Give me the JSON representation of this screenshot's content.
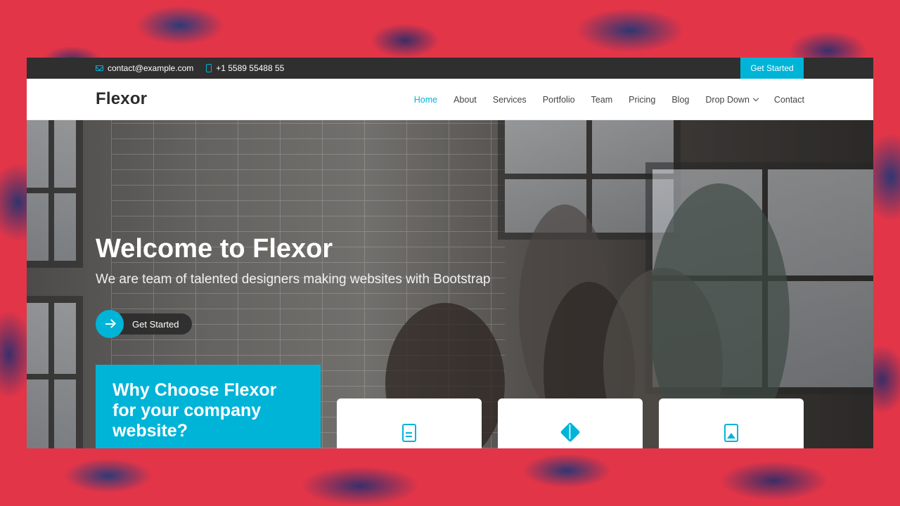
{
  "topbar": {
    "email": "contact@example.com",
    "phone": "+1 5589 55488 55",
    "cta_label": "Get Started"
  },
  "header": {
    "logo": "Flexor",
    "nav": [
      {
        "label": "Home",
        "active": true
      },
      {
        "label": "About"
      },
      {
        "label": "Services"
      },
      {
        "label": "Portfolio"
      },
      {
        "label": "Team"
      },
      {
        "label": "Pricing"
      },
      {
        "label": "Blog"
      },
      {
        "label": "Drop Down",
        "dropdown": true
      },
      {
        "label": "Contact"
      }
    ]
  },
  "hero": {
    "title": "Welcome to Flexor",
    "subtitle": "We are team of talented designers making websites with Bootstrap",
    "button_label": "Get Started"
  },
  "why": {
    "title": "Why Choose Flexor for your company website?"
  },
  "cards": [
    {
      "icon": "document-icon"
    },
    {
      "icon": "cube-icon"
    },
    {
      "icon": "image-file-icon"
    }
  ],
  "colors": {
    "accent": "#00b4d8",
    "topbar_bg": "#2f2f2f",
    "background": "#e33548"
  }
}
